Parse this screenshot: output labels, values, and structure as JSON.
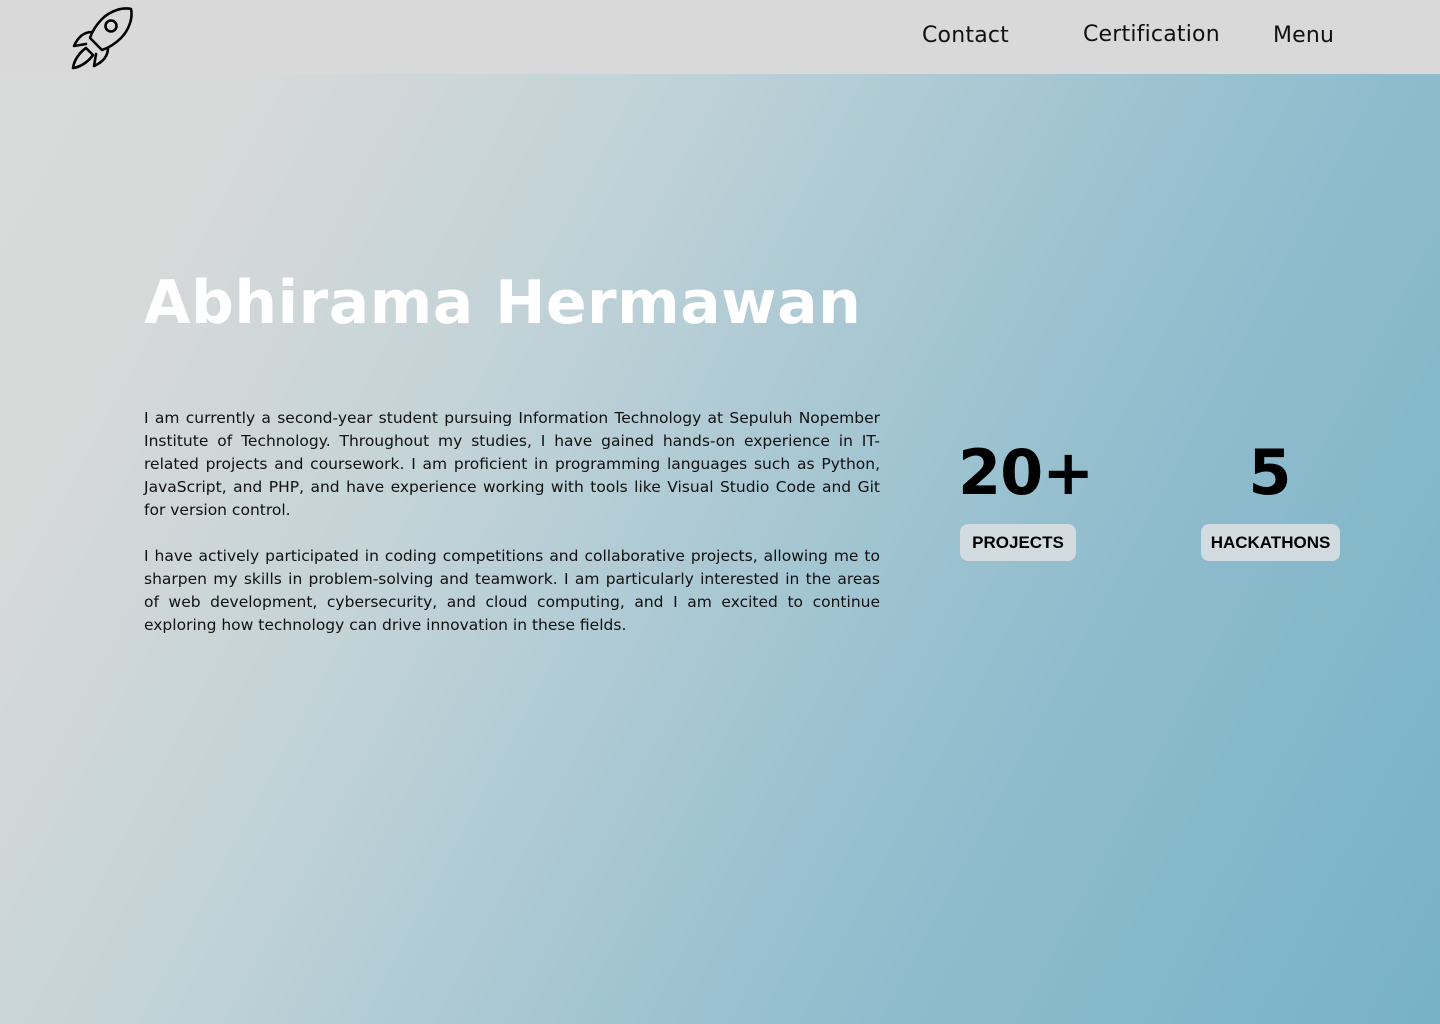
{
  "nav": {
    "logo_icon": "rocket-icon",
    "links": [
      {
        "label": "Contact"
      },
      {
        "label": "Certification"
      },
      {
        "label": "Menu"
      }
    ]
  },
  "hero": {
    "name": "Abhirama Hermawan",
    "paragraphs": [
      "I am currently a second-year student pursuing Information Technology at Sepuluh Nopember Institute of Technology. Throughout my studies, I have gained hands-on experience in IT-related projects and coursework. I am proficient in programming languages such as Python, JavaScript, and PHP, and have experience working with tools like Visual Studio Code and Git for version control.",
      "I have actively participated in coding competitions and collaborative projects, allowing me to sharpen my skills in problem-solving and teamwork. I am particularly interested in the areas of web development, cybersecurity, and cloud computing, and I am excited to continue exploring how technology can drive innovation in these fields."
    ]
  },
  "stats": [
    {
      "value": "20+",
      "label": "PROJECTS"
    },
    {
      "value": "5",
      "label": "HACKATHONS"
    }
  ],
  "colors": {
    "navbar_bg": "#d9d9d9",
    "gradient_start": "#dadada",
    "gradient_end": "#77b2c7",
    "title_text": "#ffffff",
    "badge_bg": "#d1dbe0"
  }
}
